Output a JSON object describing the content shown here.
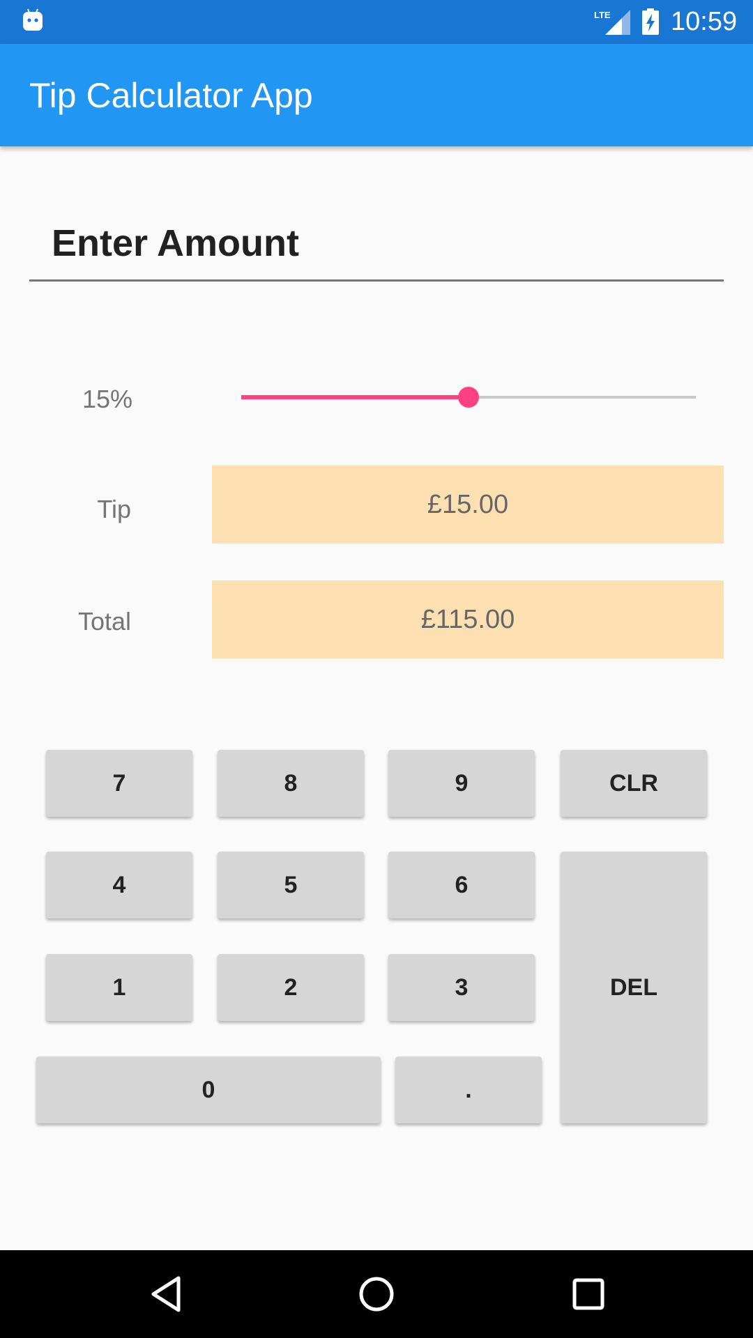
{
  "status_bar": {
    "network": "LTE",
    "time": "10:59"
  },
  "app_bar": {
    "title": "Tip Calculator App"
  },
  "amount": {
    "placeholder": "Enter Amount",
    "value": ""
  },
  "tip_slider": {
    "label": "15%",
    "value_fraction": 0.5
  },
  "results": {
    "tip_label": "Tip",
    "tip_value": "£15.00",
    "total_label": "Total",
    "total_value": "£115.00"
  },
  "keypad": {
    "k7": "7",
    "k8": "8",
    "k9": "9",
    "clr": "CLR",
    "k4": "4",
    "k5": "5",
    "k6": "6",
    "del": "DEL",
    "k1": "1",
    "k2": "2",
    "k3": "3",
    "k0": "0",
    "dot": "."
  },
  "colors": {
    "status_bar": "#1976d2",
    "app_bar": "#2196f3",
    "accent": "#ff4081",
    "result_bg": "#fde0b2",
    "key_bg": "#d6d6d6"
  },
  "icons": {
    "status_left": "android-icon",
    "signal": "lte-signal-icon",
    "battery": "battery-charging-icon",
    "nav_back": "back-triangle-icon",
    "nav_home": "home-circle-icon",
    "nav_recents": "recents-square-icon"
  }
}
